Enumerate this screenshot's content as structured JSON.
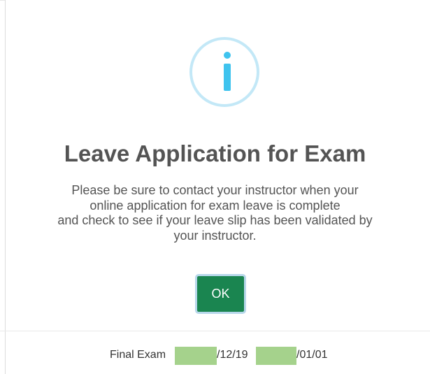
{
  "dialog": {
    "icon": "info-icon",
    "title": "Leave Application for Exam",
    "message_lines": [
      "Please be sure to contact your instructor when your",
      "online application for exam leave is complete",
      "and check to see if your leave slip has been validated by",
      "your instructor."
    ],
    "ok_label": "OK",
    "colors": {
      "icon_ring": "#c3e8f7",
      "icon_glyph": "#3fc3ee",
      "ok_button": "#1a8550",
      "ok_focus_ring": "#b7d7ea",
      "title_text": "#545454"
    }
  },
  "background_row": {
    "label": "Final Exam",
    "date_start_suffix": "/12/19",
    "date_end_suffix": "/01/01",
    "redaction_color": "#a5d28c"
  }
}
